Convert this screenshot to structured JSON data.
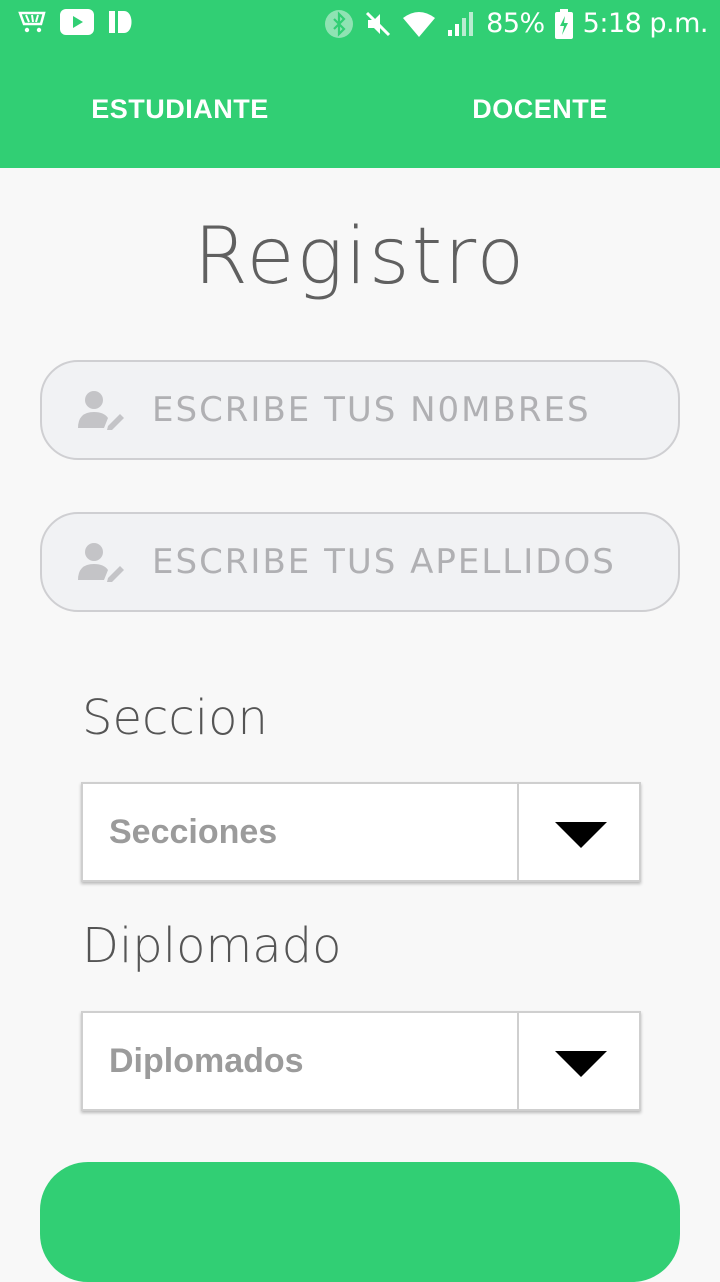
{
  "status_bar": {
    "battery": "85%",
    "time": "5:18 p.m."
  },
  "tabs": [
    {
      "label": "ESTUDIANTE"
    },
    {
      "label": "DOCENTE"
    }
  ],
  "form": {
    "title": "Registro",
    "names_placeholder": "ESCRIBE TUS N0MBRES",
    "surnames_placeholder": "ESCRIBE TUS APELLIDOS",
    "section_label": "Seccion",
    "section_select_value": "Secciones",
    "diploma_label": "Diplomado",
    "diploma_select_value": "Diplomados"
  },
  "colors": {
    "accent": "#31cf74"
  }
}
